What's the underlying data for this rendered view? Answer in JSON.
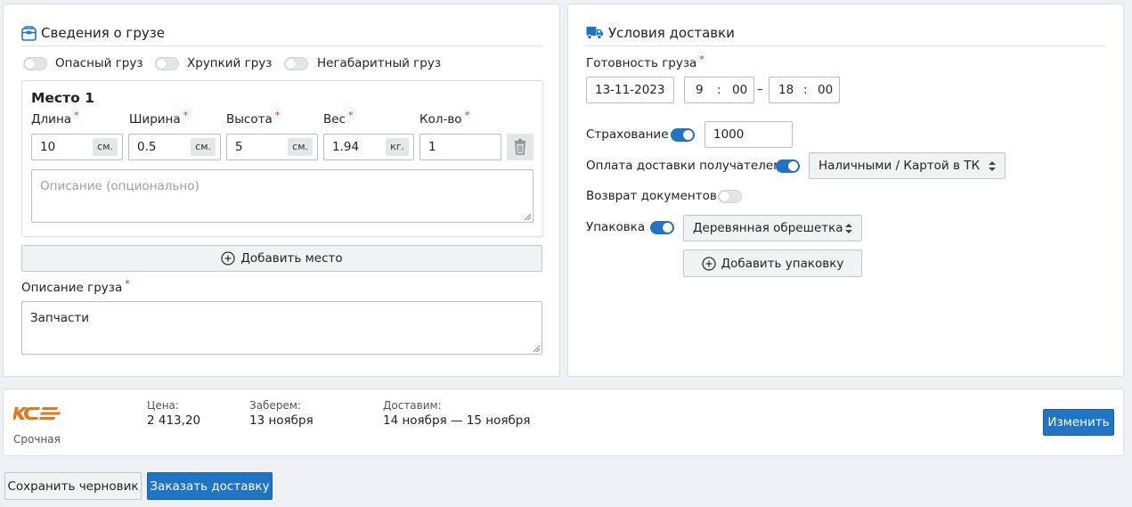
{
  "cargo": {
    "title": "Сведения о грузе",
    "toggles": [
      {
        "label": "Опасный груз",
        "on": false
      },
      {
        "label": "Хрупкий груз",
        "on": false
      },
      {
        "label": "Негабаритный груз",
        "on": false
      }
    ],
    "place": {
      "title": "Место 1",
      "fields": [
        {
          "label": "Длина",
          "value": "10",
          "unit": "см."
        },
        {
          "label": "Ширина",
          "value": "0.5",
          "unit": "см."
        },
        {
          "label": "Высота",
          "value": "5",
          "unit": "см."
        },
        {
          "label": "Вес",
          "value": "1.94",
          "unit": "кг."
        },
        {
          "label": "Кол-во",
          "value": "1",
          "unit": ""
        }
      ],
      "description_placeholder": "Описание (опционально)"
    },
    "add_place_label": "Добавить место",
    "description_label": "Описание груза",
    "description_value": "Запчасти"
  },
  "delivery": {
    "title": "Условия доставки",
    "readiness_label": "Готовность груза",
    "date": "13-11-2023",
    "time_from_h": "9",
    "time_from_m": "00",
    "time_to_h": "18",
    "time_to_m": "00",
    "separator_colon": ":",
    "range_dash": "–",
    "insurance_label": "Страхование",
    "insurance_on": true,
    "insurance_value": "1000",
    "payment_label": "Оплата доставки получателем",
    "payment_on": true,
    "payment_method": "Наличными / Картой в ТК",
    "return_docs_label": "Возврат документов",
    "return_docs_on": false,
    "packaging_label": "Упаковка",
    "packaging_on": true,
    "packaging_value": "Деревянная обрешетка",
    "add_packaging_label": "Добавить упаковку"
  },
  "summary": {
    "carrier_service": "Срочная",
    "price_label": "Цена:",
    "price_value": "2 413,20",
    "pickup_label": "Заберем:",
    "pickup_value": "13 ноября",
    "deliver_label": "Доставим:",
    "deliver_value": "14 ноября — 15 ноября",
    "change_label": "Изменить"
  },
  "footer": {
    "save_draft_label": "Сохранить черновик",
    "order_label": "Заказать доставку"
  },
  "colors": {
    "accent": "#1f74c3",
    "logo": "#e8751a",
    "required": "#d02a2a"
  }
}
